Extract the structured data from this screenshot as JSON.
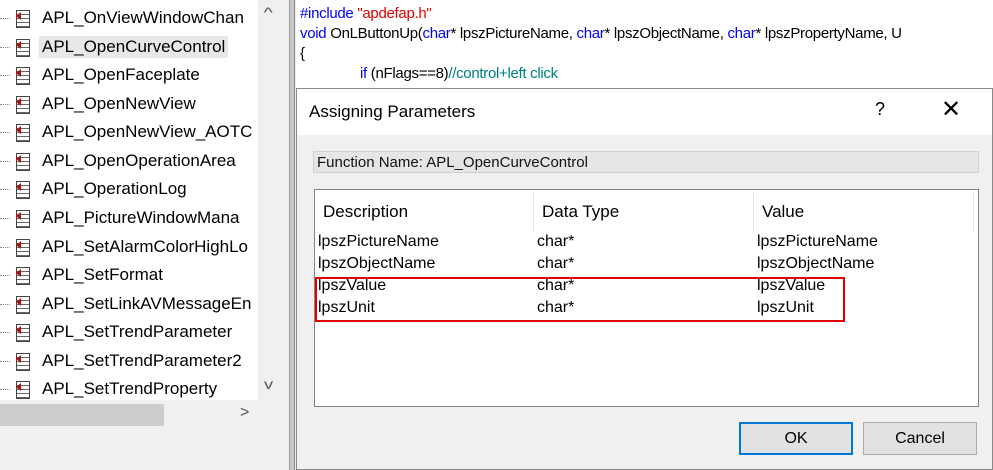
{
  "tree": {
    "items": [
      "APL_OnViewWindowChan",
      "APL_OpenCurveControl",
      "APL_OpenFaceplate",
      "APL_OpenNewView",
      "APL_OpenNewView_AOTC",
      "APL_OpenOperationArea",
      "APL_OperationLog",
      "APL_PictureWindowMana",
      "APL_SetAlarmColorHighLo",
      "APL_SetFormat",
      "APL_SetLinkAVMessageEn",
      "APL_SetTrendParameter",
      "APL_SetTrendParameter2",
      "APL_SetTrendProperty"
    ],
    "selected": 1,
    "scroll_up": "^",
    "scroll_down": "v",
    "scroll_right": ">"
  },
  "code": {
    "include_kw": "#include",
    "include_file": "\"apdefap.h\"",
    "l2_void": "void",
    "l2_fn": " OnLButtonUp(",
    "char": "char",
    "p1": "* lpszPictureName, ",
    "p2": "* lpszObjectName, ",
    "p3": "* lpszPropertyName, U",
    "brace": "{",
    "if_kw": "if",
    "cond": " (nFlags==8)",
    "comment": "//control+left click"
  },
  "dialog": {
    "title": "Assigning Parameters",
    "help": "?",
    "close": "✕",
    "function_name": "Function Name: APL_OpenCurveControl",
    "columns": [
      "Description",
      "Data Type",
      "Value"
    ],
    "rows": [
      [
        "lpszPictureName",
        "char*",
        "lpszPictureName"
      ],
      [
        "lpszObjectName",
        "char*",
        "lpszObjectName"
      ],
      [
        "lpszValue",
        "char*",
        "lpszValue"
      ],
      [
        "lpszUnit",
        "char*",
        "lpszUnit"
      ]
    ],
    "ok": "OK",
    "cancel": "Cancel",
    "highlight_color": "#e00000"
  }
}
